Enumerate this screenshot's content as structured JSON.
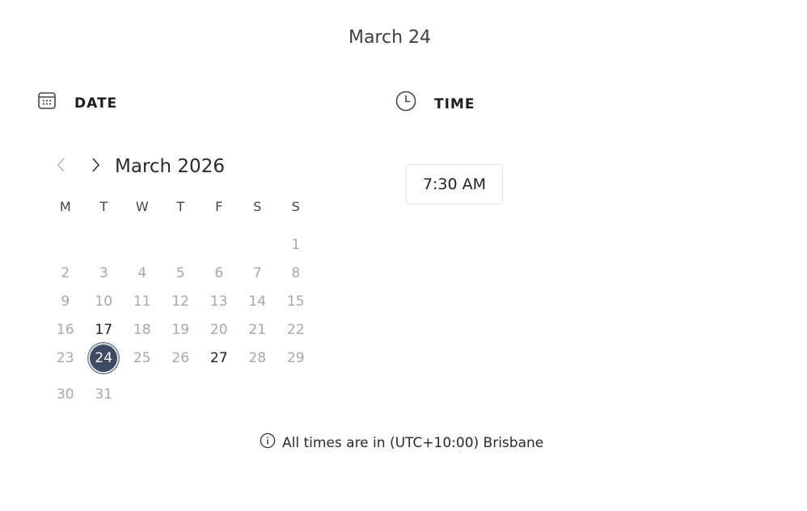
{
  "heading": "March 24",
  "date_section": {
    "label": "DATE",
    "icon": "calendar-icon"
  },
  "time_section": {
    "label": "TIME",
    "icon": "clock-icon"
  },
  "calendar": {
    "month_title": "March 2026",
    "prev_icon": "chevron-left-icon",
    "next_icon": "chevron-right-icon",
    "weekdays": [
      "M",
      "T",
      "W",
      "T",
      "F",
      "S",
      "S"
    ],
    "weeks": [
      [
        "",
        "",
        "",
        "",
        "",
        "",
        "1"
      ],
      [
        "2",
        "3",
        "4",
        "5",
        "6",
        "7",
        "8"
      ],
      [
        "9",
        "10",
        "11",
        "12",
        "13",
        "14",
        "15"
      ],
      [
        "16",
        "17",
        "18",
        "19",
        "20",
        "21",
        "22"
      ],
      [
        "23",
        "24",
        "25",
        "26",
        "27",
        "28",
        "29"
      ],
      [
        "30",
        "31",
        "",
        "",
        "",
        "",
        ""
      ]
    ],
    "available_days": [
      "17",
      "24",
      "27"
    ],
    "selected_day": "24",
    "selected_color": "#3d4a63"
  },
  "time_slots": [
    "7:30 AM"
  ],
  "timezone_note": {
    "icon": "info-icon",
    "text": "All times are in (UTC+10:00) Brisbane"
  }
}
